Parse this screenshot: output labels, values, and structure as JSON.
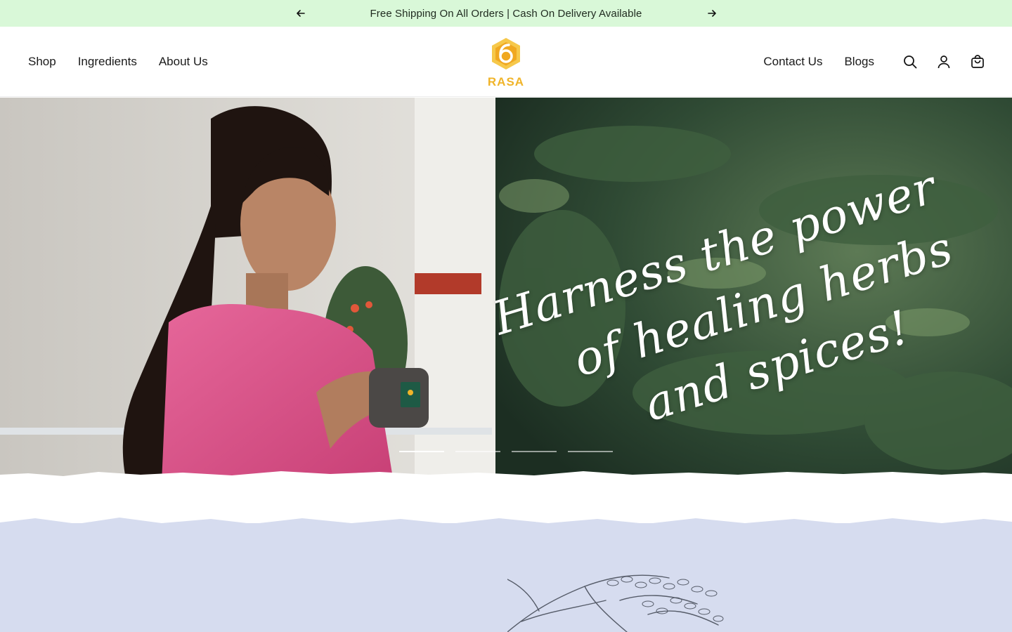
{
  "announcement": {
    "text": "Free Shipping On All Orders | Cash On Delivery Available",
    "prev_icon": "arrow-left-icon",
    "next_icon": "arrow-right-icon",
    "background": "#d9f8d8"
  },
  "header": {
    "nav_left": [
      {
        "label": "Shop"
      },
      {
        "label": "Ingredients"
      },
      {
        "label": "About Us"
      }
    ],
    "logo_text": "RASA",
    "nav_right": [
      {
        "label": "Contact Us"
      },
      {
        "label": "Blogs"
      }
    ],
    "icons": [
      "search-icon",
      "account-icon",
      "cart-icon"
    ]
  },
  "hero": {
    "headline_lines": [
      "Harness the power",
      "of healing herbs",
      "and spices!"
    ],
    "slides": 4,
    "active_slide": 1
  },
  "colors": {
    "brand_gold": "#f0b429",
    "lavender": "#d6dcef",
    "foliage": "#2f4a34"
  }
}
